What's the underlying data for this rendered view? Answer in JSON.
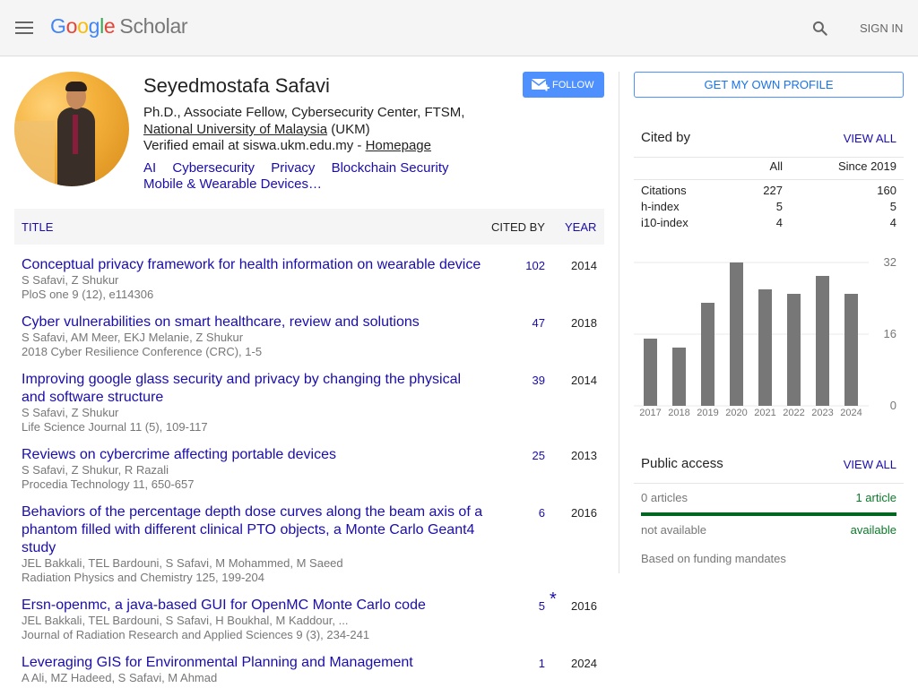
{
  "header": {
    "logo_google": [
      "G",
      "o",
      "o",
      "g",
      "l",
      "e"
    ],
    "logo_product": "Scholar",
    "sign_in": "SIGN IN",
    "icons": {
      "menu": "hamburger-menu-icon",
      "search": "search-icon"
    }
  },
  "profile": {
    "name": "Seyedmostafa Safavi",
    "affiliation_line1": "Ph.D., Associate Fellow, Cybersecurity Center, FTSM,",
    "university": "National University of Malaysia",
    "university_suffix": " (UKM)",
    "email_text": "Verified email at siswa.ukm.edu.my - ",
    "homepage_label": "Homepage",
    "interests": [
      "AI",
      "Cybersecurity",
      "Privacy",
      "Blockchain Security",
      "Mobile & Wearable Devices…"
    ],
    "follow_label": "FOLLOW"
  },
  "table": {
    "col_title": "TITLE",
    "col_cited": "CITED BY",
    "col_year": "YEAR",
    "rows": [
      {
        "title": "Conceptual privacy framework for health information on wearable device",
        "authors": "S Safavi, Z Shukur",
        "venue": "PloS one 9 (12), e114306",
        "cited": "102",
        "year": "2014",
        "star": ""
      },
      {
        "title": "Cyber vulnerabilities on smart healthcare, review and solutions",
        "authors": "S Safavi, AM Meer, EKJ Melanie, Z Shukur",
        "venue": "2018 Cyber Resilience Conference (CRC), 1-5",
        "cited": "47",
        "year": "2018",
        "star": ""
      },
      {
        "title": "Improving google glass security and privacy by changing the physical and software structure",
        "authors": "S Safavi, Z Shukur",
        "venue": "Life Science Journal 11 (5), 109-117",
        "cited": "39",
        "year": "2014",
        "star": ""
      },
      {
        "title": "Reviews on cybercrime affecting portable devices",
        "authors": "S Safavi, Z Shukur, R Razali",
        "venue": "Procedia Technology 11, 650-657",
        "cited": "25",
        "year": "2013",
        "star": ""
      },
      {
        "title": "Behaviors of the percentage depth dose curves along the beam axis of a phantom filled with different clinical PTO objects, a Monte Carlo Geant4 study",
        "authors": "JEL Bakkali, TEL Bardouni, S Safavi, M Mohammed, M Saeed",
        "venue": "Radiation Physics and Chemistry 125, 199-204",
        "cited": "6",
        "year": "2016",
        "star": ""
      },
      {
        "title": "Ersn-openmc, a java-based GUI for OpenMC Monte Carlo code",
        "authors": "JEL Bakkali, TEL Bardouni, S Safavi, H Boukhal, M Kaddour, ...",
        "venue": "Journal of Radiation Research and Applied Sciences 9 (3), 234-241",
        "cited": "5",
        "year": "2016",
        "star": "*"
      },
      {
        "title": "Leveraging GIS for Environmental Planning and Management",
        "authors": "A Ali, MZ Hadeed, S Safavi, M Ahmad",
        "venue": "",
        "cited": "1",
        "year": "2024",
        "star": ""
      }
    ]
  },
  "sidebar": {
    "own_profile_label": "GET MY OWN PROFILE",
    "cited_by": {
      "title": "Cited by",
      "view_all": "VIEW ALL",
      "col_all": "All",
      "col_since": "Since 2019",
      "rows": [
        {
          "label": "Citations",
          "all": "227",
          "since": "160"
        },
        {
          "label": "h-index",
          "all": "5",
          "since": "5"
        },
        {
          "label": "i10-index",
          "all": "4",
          "since": "4"
        }
      ]
    },
    "public_access": {
      "title": "Public access",
      "view_all": "VIEW ALL",
      "not_available_count": "0 articles",
      "available_count": "1 article",
      "not_available_label": "not available",
      "available_label": "available",
      "available_fraction": 1.0,
      "note": "Based on funding mandates"
    }
  },
  "chart_data": {
    "type": "bar",
    "title": "",
    "xlabel": "",
    "ylabel": "",
    "categories": [
      "2017",
      "2018",
      "2019",
      "2020",
      "2021",
      "2022",
      "2023",
      "2024"
    ],
    "values": [
      15,
      13,
      23,
      32,
      26,
      25,
      29,
      25
    ],
    "ylim": [
      0,
      32
    ],
    "yticks": [
      "0",
      "16",
      "32"
    ],
    "grid": true,
    "bar_color": "#777777"
  }
}
